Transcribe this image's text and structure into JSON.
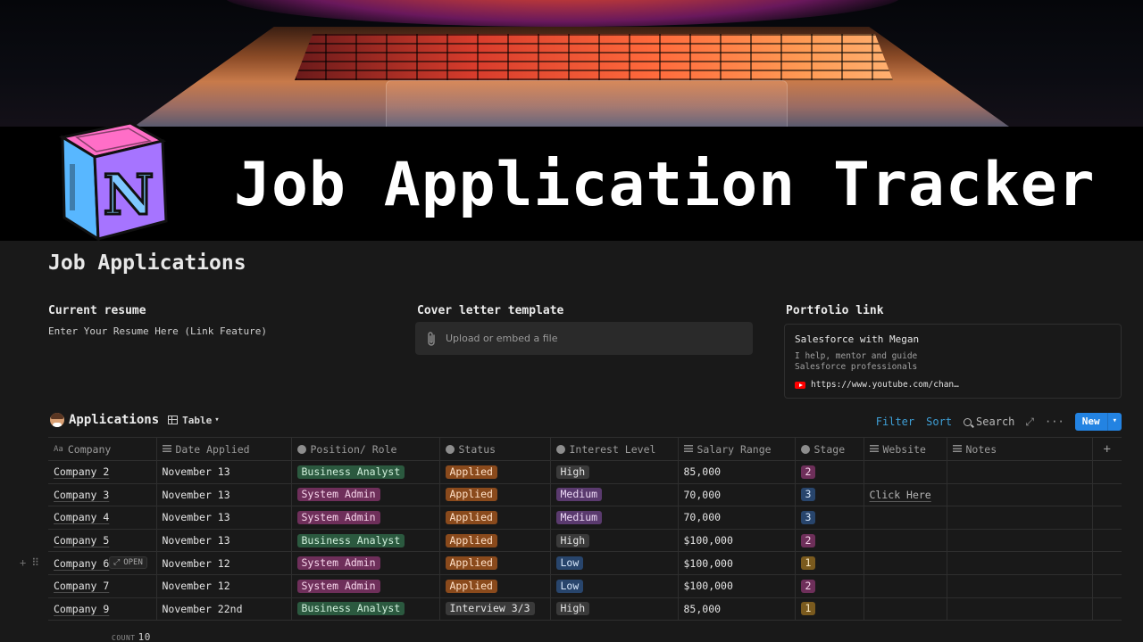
{
  "banner": {
    "title": "Job Application Tracker"
  },
  "page": {
    "title": "Job Applications",
    "properties": {
      "resume": {
        "label": "Current resume",
        "value": "Enter Your Resume Here (Link Feature)"
      },
      "cover_letter": {
        "label": "Cover letter template",
        "upload_text": "Upload or embed a file"
      },
      "portfolio": {
        "label": "Portfolio link",
        "bookmark_title": "Salesforce with Megan",
        "bookmark_desc": "I help, mentor and guide Salesforce professionals",
        "bookmark_url": "https://www.youtube.com/chan…"
      }
    }
  },
  "database": {
    "title": "Applications",
    "view_label": "Table",
    "toolbar": {
      "filter": "Filter",
      "sort": "Sort",
      "search": "Search",
      "new": "New"
    },
    "columns": [
      {
        "label": "Company",
        "icon": "title-icon"
      },
      {
        "label": "Date Applied",
        "icon": "text-icon"
      },
      {
        "label": "Position/ Role",
        "icon": "select-icon"
      },
      {
        "label": "Status",
        "icon": "select-icon"
      },
      {
        "label": "Interest Level",
        "icon": "select-icon"
      },
      {
        "label": "Salary Range",
        "icon": "text-icon"
      },
      {
        "label": "Stage",
        "icon": "select-icon"
      },
      {
        "label": "Website",
        "icon": "text-icon"
      },
      {
        "label": "Notes",
        "icon": "text-icon"
      }
    ],
    "rows": [
      {
        "company": "Company 2",
        "date": "November 13",
        "position": "Business Analyst",
        "status": "Applied",
        "interest": "High",
        "salary": "85,000",
        "stage": "2",
        "website": "",
        "notes": ""
      },
      {
        "company": "Company 3",
        "date": "November 13",
        "position": "System Admin",
        "status": "Applied",
        "interest": "Medium",
        "salary": "70,000",
        "stage": "3",
        "website": "Click Here",
        "notes": ""
      },
      {
        "company": "Company 4",
        "date": "November 13",
        "position": "System Admin",
        "status": "Applied",
        "interest": "Medium",
        "salary": "70,000",
        "stage": "3",
        "website": "",
        "notes": ""
      },
      {
        "company": "Company 5",
        "date": "November 13",
        "position": "Business Analyst",
        "status": "Applied",
        "interest": "High",
        "salary": "$100,000",
        "stage": "2",
        "website": "",
        "notes": ""
      },
      {
        "company": "Company 6",
        "date": "November 12",
        "position": "System Admin",
        "status": "Applied",
        "interest": "Low",
        "salary": "$100,000",
        "stage": "1",
        "website": "",
        "notes": ""
      },
      {
        "company": "Company 7",
        "date": "November 12",
        "position": "System Admin",
        "status": "Applied",
        "interest": "Low",
        "salary": "$100,000",
        "stage": "2",
        "website": "",
        "notes": ""
      },
      {
        "company": "Company 9",
        "date": "November 22nd",
        "position": "Business Analyst",
        "status": "Interview 3/3",
        "interest": "High",
        "salary": "85,000",
        "stage": "1",
        "website": "",
        "notes": ""
      }
    ],
    "hover_row": {
      "open_label": "OPEN"
    },
    "footer": {
      "count_label": "COUNT",
      "count_value": "10"
    }
  },
  "colors": {
    "tag_green": "#2b593f",
    "tag_green_text": "#d1f0dc",
    "tag_purple": "#5a3a6e",
    "tag_purple_text": "#ecd9f5",
    "tag_orange": "#8a4a1c",
    "tag_orange_text": "#ffe1c8",
    "tag_gray": "#3a3a3a",
    "tag_gray_text": "#e6e6e6",
    "tag_blue": "#28456c",
    "tag_blue_text": "#d6e6fa",
    "tag_pink": "#6e2f5a",
    "tag_pink_text": "#f8d6ec",
    "tag_brown": "#7a5a1e",
    "tag_brown_text": "#fbe9c4",
    "accent": "#2383e2"
  }
}
